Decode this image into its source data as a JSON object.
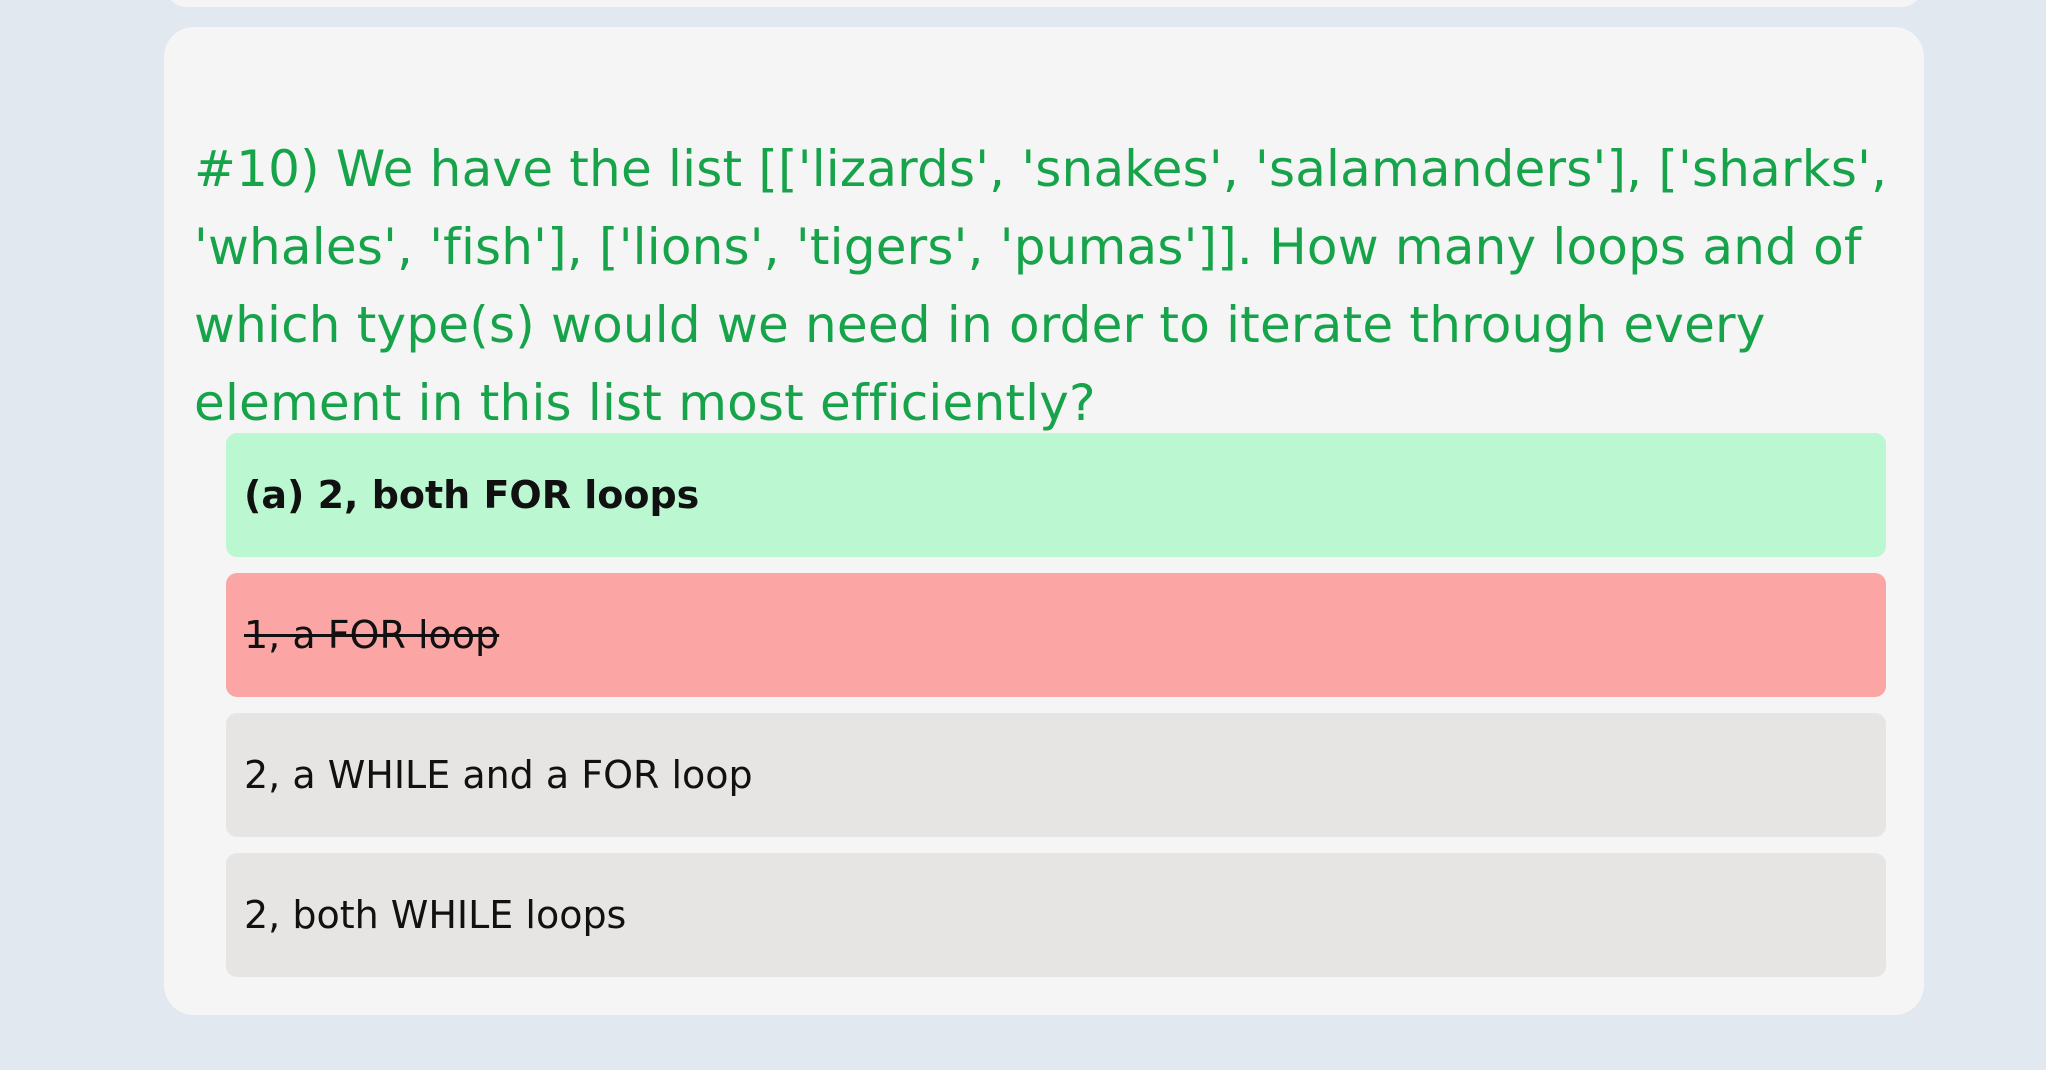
{
  "question": {
    "text": "#10) We have the list [['lizards', 'snakes', 'salamanders'], ['sharks', 'whales', 'fish'], ['lions', 'tigers', 'pumas']]. How many loops and of which type(s) would we need in order to iterate through every element in this list most efficiently?"
  },
  "answers": [
    {
      "label": "(a) 2, both FOR loops",
      "state": "correct"
    },
    {
      "label": "1, a FOR loop",
      "state": "incorrect"
    },
    {
      "label": "2, a WHILE and a FOR loop",
      "state": "neutral"
    },
    {
      "label": "2, both WHILE loops",
      "state": "neutral"
    }
  ],
  "colors": {
    "page_background": "#e2e8f0",
    "card_background": "#f5f5f5",
    "question_text": "#16a34a",
    "correct_answer": "#bbf7d0",
    "incorrect_answer": "#fca5a5",
    "neutral_answer": "#e7e5e4"
  }
}
